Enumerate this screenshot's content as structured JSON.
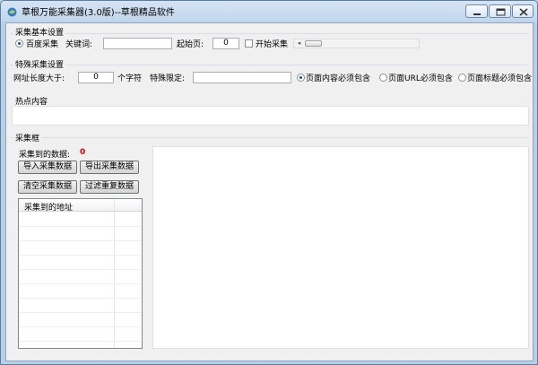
{
  "window": {
    "title": "草根万能采集器(3.0版)--草根精品软件",
    "controls": {
      "minimize": "minimize",
      "maximize": "maximize",
      "close": "close"
    }
  },
  "basic_group": {
    "title": "采集基本设置",
    "radio_label": "百度采集",
    "keyword_label": "关键词:",
    "keyword_value": "",
    "start_page_label": "起始页:",
    "start_page_value": "0",
    "start_checkbox_label": "开始采集",
    "start_checked": false
  },
  "special_group": {
    "title": "特殊采集设置",
    "url_len_label": "网址长度大于:",
    "url_len_value": "0",
    "unit_label": "个字符",
    "limit_label": "特殊限定:",
    "limit_value": "",
    "options": [
      {
        "label": "页面内容必须包含",
        "selected": true
      },
      {
        "label": "页面URL必须包含",
        "selected": false
      },
      {
        "label": "页面标题必须包含",
        "selected": false
      }
    ]
  },
  "hot_group": {
    "title": "热点内容",
    "value": ""
  },
  "collect_group": {
    "title": "采集框",
    "count_label": "采集到的数据:",
    "count_value": "0",
    "count_color": "#e00000",
    "buttons": {
      "import": "导入采集数据",
      "export": "导出采集数据",
      "clear": "清空采集数据",
      "dedupe": "过滤重复数据"
    },
    "list_column": "采集到的地址"
  },
  "colors": {
    "accent": "#1e4d8c",
    "title_bar": "#c3d7ec"
  }
}
